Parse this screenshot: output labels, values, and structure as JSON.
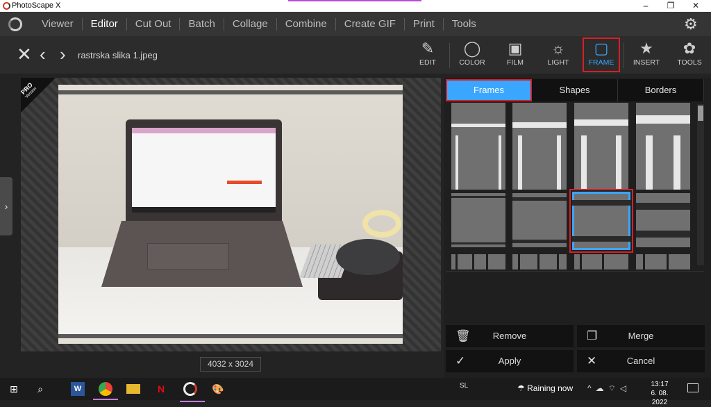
{
  "window": {
    "title": "PhotoScape X",
    "controls": [
      "–",
      "❐",
      "✕"
    ]
  },
  "menu": {
    "items": [
      "Viewer",
      "Editor",
      "Cut Out",
      "Batch",
      "Collage",
      "Combine",
      "Create GIF",
      "Print",
      "Tools"
    ],
    "active": "Editor"
  },
  "file": {
    "name": "rastrska slika 1.jpeg",
    "dimensions": "4032 x 3024"
  },
  "tools": [
    {
      "id": "edit",
      "label": "EDIT",
      "icon": "✎"
    },
    {
      "id": "color",
      "label": "COLOR",
      "icon": "◯"
    },
    {
      "id": "film",
      "label": "FILM",
      "icon": "▣"
    },
    {
      "id": "light",
      "label": "LIGHT",
      "icon": "☼"
    },
    {
      "id": "frame",
      "label": "FRAME",
      "icon": "▢"
    },
    {
      "id": "insert",
      "label": "INSERT",
      "icon": "★"
    },
    {
      "id": "tools",
      "label": "TOOLS",
      "icon": "✿"
    }
  ],
  "active_tool": "FRAME",
  "badge": {
    "top": "PRO",
    "bottom": "Version"
  },
  "panel": {
    "tabs": [
      "Frames",
      "Shapes",
      "Borders"
    ],
    "active_tab": "Frames",
    "buttons": {
      "remove": "Remove",
      "merge": "Merge",
      "apply": "Apply",
      "cancel": "Cancel"
    }
  },
  "taskbar": {
    "language": "SL",
    "weather": "Raining now",
    "time": "13:17",
    "date": "6. 08. 2022"
  },
  "colors": {
    "accent": "#3aa6ff",
    "highlight": "#d81f26",
    "background": "#232323"
  }
}
